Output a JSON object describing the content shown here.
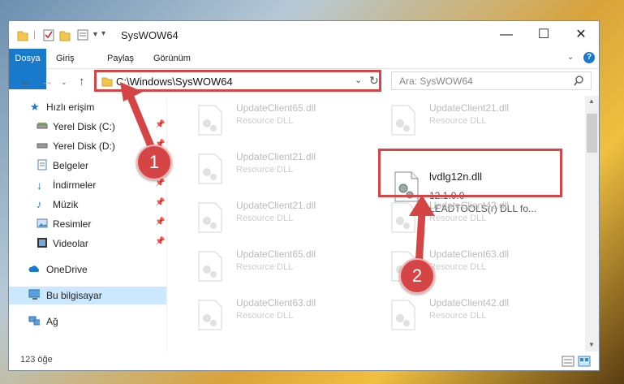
{
  "window": {
    "title": "SysWOW64",
    "controls": [
      "minimize-icon",
      "maximize-icon",
      "close-icon"
    ]
  },
  "ribbon": {
    "tabs": [
      "Dosya",
      "Giriş",
      "Paylaş",
      "Görünüm"
    ],
    "help": "?"
  },
  "addressbar": {
    "path": "C:\\Windows\\SysWOW64",
    "search_placeholder": "Ara: SysWOW64"
  },
  "sidebar": {
    "items": [
      {
        "label": "Hızlı erişim",
        "icon": "star-icon"
      },
      {
        "label": "Yerel Disk (C:)",
        "icon": "drive-icon",
        "pinned": true
      },
      {
        "label": "Yerel Disk (D:)",
        "icon": "drive-icon",
        "pinned": true
      },
      {
        "label": "Belgeler",
        "icon": "document-icon",
        "pinned": true
      },
      {
        "label": "İndirmeler",
        "icon": "download-icon",
        "pinned": true
      },
      {
        "label": "Müzik",
        "icon": "music-icon",
        "pinned": true
      },
      {
        "label": "Resimler",
        "icon": "pictures-icon",
        "pinned": true
      },
      {
        "label": "Videolar",
        "icon": "video-icon",
        "pinned": true
      },
      {
        "label": "OneDrive",
        "icon": "cloud-icon"
      },
      {
        "label": "Bu bilgisayar",
        "icon": "computer-icon",
        "selected": true
      },
      {
        "label": "Ağ",
        "icon": "network-icon"
      }
    ]
  },
  "files": [
    {
      "name": "UpdateClient65.dll",
      "type": "Resource DLL"
    },
    {
      "name": "UpdateClient21.dll",
      "type": "Resource DLL"
    },
    {
      "name": "UpdateClient21.dll",
      "type": "Resource DLL"
    },
    {
      "name": "lvdlg12n.dll",
      "version": "12.1.0.0",
      "description": "LEADTOOLS(r) DLL fo...",
      "highlighted": true
    },
    {
      "name": "UpdateClient21.dll",
      "type": "Resource DLL"
    },
    {
      "name": "UpdateClient42.dll",
      "type": "Resource DLL"
    },
    {
      "name": "UpdateClient65.dll",
      "type": "Resource DLL"
    },
    {
      "name": "UpdateClient63.dll",
      "type": "Resource DLL"
    },
    {
      "name": "UpdateClient63.dll",
      "type": "Resource DLL"
    },
    {
      "name": "UpdateClient42.dll",
      "type": "Resource DLL"
    }
  ],
  "status": {
    "count": "123 öğe"
  },
  "annotations": {
    "step1": "1",
    "step2": "2",
    "color": "#d64545"
  }
}
